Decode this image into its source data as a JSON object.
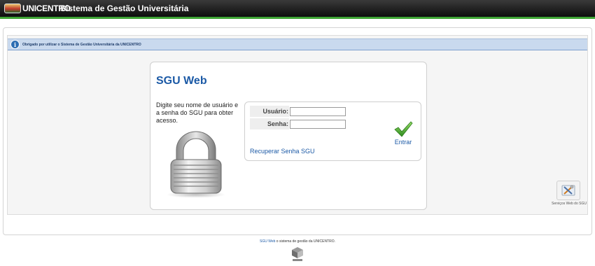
{
  "header": {
    "logo_text": "UNICENTRO",
    "title": "Sistema de Gestão Universitária",
    "accent_color": "#3fa535"
  },
  "info_bar": {
    "message": "Obrigado por utilizar o Sistema de Gestão Universitária da UNICENTRO",
    "icon": "info-icon"
  },
  "login": {
    "title": "SGU Web",
    "instructions": "Digite seu nome de usuário e a senha do SGU para obter acesso.",
    "username_label": "Usuário:",
    "username_value": "",
    "password_label": "Senha:",
    "password_value": "",
    "enter_label": "Entrar",
    "recover_link": "Recuperar Senha SGU"
  },
  "services": {
    "label": "Serviços Web do SGU",
    "icon": "tools-icon"
  },
  "footer": {
    "link_text": "SGU Web",
    "text": " o sistema de gestão da UNICENTRO.",
    "logo_icon": "cube-logo-icon"
  },
  "colors": {
    "link": "#1c5aa6",
    "info_bar_bg": "#c9d9ee"
  }
}
